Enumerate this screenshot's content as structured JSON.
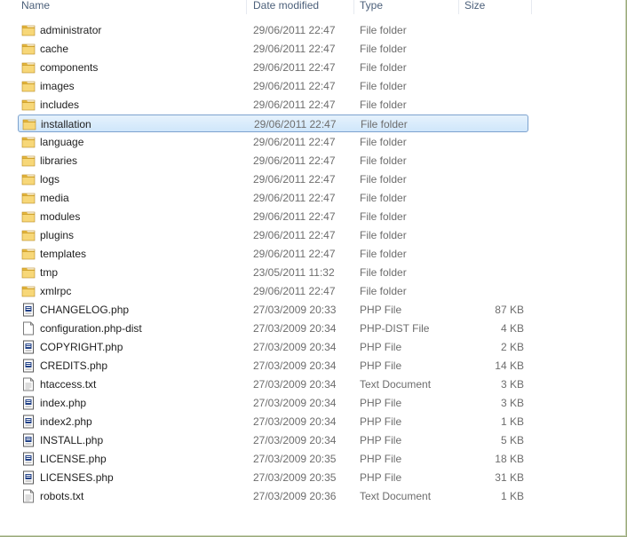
{
  "columns": {
    "name": "Name",
    "date": "Date modified",
    "type": "Type",
    "size": "Size"
  },
  "selected_index": 5,
  "rows": [
    {
      "name": "administrator",
      "date": "29/06/2011 22:47",
      "type": "File folder",
      "size": "",
      "icon": "folder-icon"
    },
    {
      "name": "cache",
      "date": "29/06/2011 22:47",
      "type": "File folder",
      "size": "",
      "icon": "folder-icon"
    },
    {
      "name": "components",
      "date": "29/06/2011 22:47",
      "type": "File folder",
      "size": "",
      "icon": "folder-icon"
    },
    {
      "name": "images",
      "date": "29/06/2011 22:47",
      "type": "File folder",
      "size": "",
      "icon": "folder-icon"
    },
    {
      "name": "includes",
      "date": "29/06/2011 22:47",
      "type": "File folder",
      "size": "",
      "icon": "folder-icon"
    },
    {
      "name": "installation",
      "date": "29/06/2011 22:47",
      "type": "File folder",
      "size": "",
      "icon": "folder-icon"
    },
    {
      "name": "language",
      "date": "29/06/2011 22:47",
      "type": "File folder",
      "size": "",
      "icon": "folder-icon"
    },
    {
      "name": "libraries",
      "date": "29/06/2011 22:47",
      "type": "File folder",
      "size": "",
      "icon": "folder-icon"
    },
    {
      "name": "logs",
      "date": "29/06/2011 22:47",
      "type": "File folder",
      "size": "",
      "icon": "folder-icon"
    },
    {
      "name": "media",
      "date": "29/06/2011 22:47",
      "type": "File folder",
      "size": "",
      "icon": "folder-icon"
    },
    {
      "name": "modules",
      "date": "29/06/2011 22:47",
      "type": "File folder",
      "size": "",
      "icon": "folder-icon"
    },
    {
      "name": "plugins",
      "date": "29/06/2011 22:47",
      "type": "File folder",
      "size": "",
      "icon": "folder-icon"
    },
    {
      "name": "templates",
      "date": "29/06/2011 22:47",
      "type": "File folder",
      "size": "",
      "icon": "folder-icon"
    },
    {
      "name": "tmp",
      "date": "23/05/2011 11:32",
      "type": "File folder",
      "size": "",
      "icon": "folder-icon"
    },
    {
      "name": "xmlrpc",
      "date": "29/06/2011 22:47",
      "type": "File folder",
      "size": "",
      "icon": "folder-icon"
    },
    {
      "name": "CHANGELOG.php",
      "date": "27/03/2009 20:33",
      "type": "PHP File",
      "size": "87 KB",
      "icon": "php-file-icon"
    },
    {
      "name": "configuration.php-dist",
      "date": "27/03/2009 20:34",
      "type": "PHP-DIST File",
      "size": "4 KB",
      "icon": "blank-file-icon"
    },
    {
      "name": "COPYRIGHT.php",
      "date": "27/03/2009 20:34",
      "type": "PHP File",
      "size": "2 KB",
      "icon": "php-file-icon"
    },
    {
      "name": "CREDITS.php",
      "date": "27/03/2009 20:34",
      "type": "PHP File",
      "size": "14 KB",
      "icon": "php-file-icon"
    },
    {
      "name": "htaccess.txt",
      "date": "27/03/2009 20:34",
      "type": "Text Document",
      "size": "3 KB",
      "icon": "text-file-icon"
    },
    {
      "name": "index.php",
      "date": "27/03/2009 20:34",
      "type": "PHP File",
      "size": "3 KB",
      "icon": "php-file-icon"
    },
    {
      "name": "index2.php",
      "date": "27/03/2009 20:34",
      "type": "PHP File",
      "size": "1 KB",
      "icon": "php-file-icon"
    },
    {
      "name": "INSTALL.php",
      "date": "27/03/2009 20:34",
      "type": "PHP File",
      "size": "5 KB",
      "icon": "php-file-icon"
    },
    {
      "name": "LICENSE.php",
      "date": "27/03/2009 20:35",
      "type": "PHP File",
      "size": "18 KB",
      "icon": "php-file-icon"
    },
    {
      "name": "LICENSES.php",
      "date": "27/03/2009 20:35",
      "type": "PHP File",
      "size": "31 KB",
      "icon": "php-file-icon"
    },
    {
      "name": "robots.txt",
      "date": "27/03/2009 20:36",
      "type": "Text Document",
      "size": "1 KB",
      "icon": "text-file-icon"
    }
  ]
}
